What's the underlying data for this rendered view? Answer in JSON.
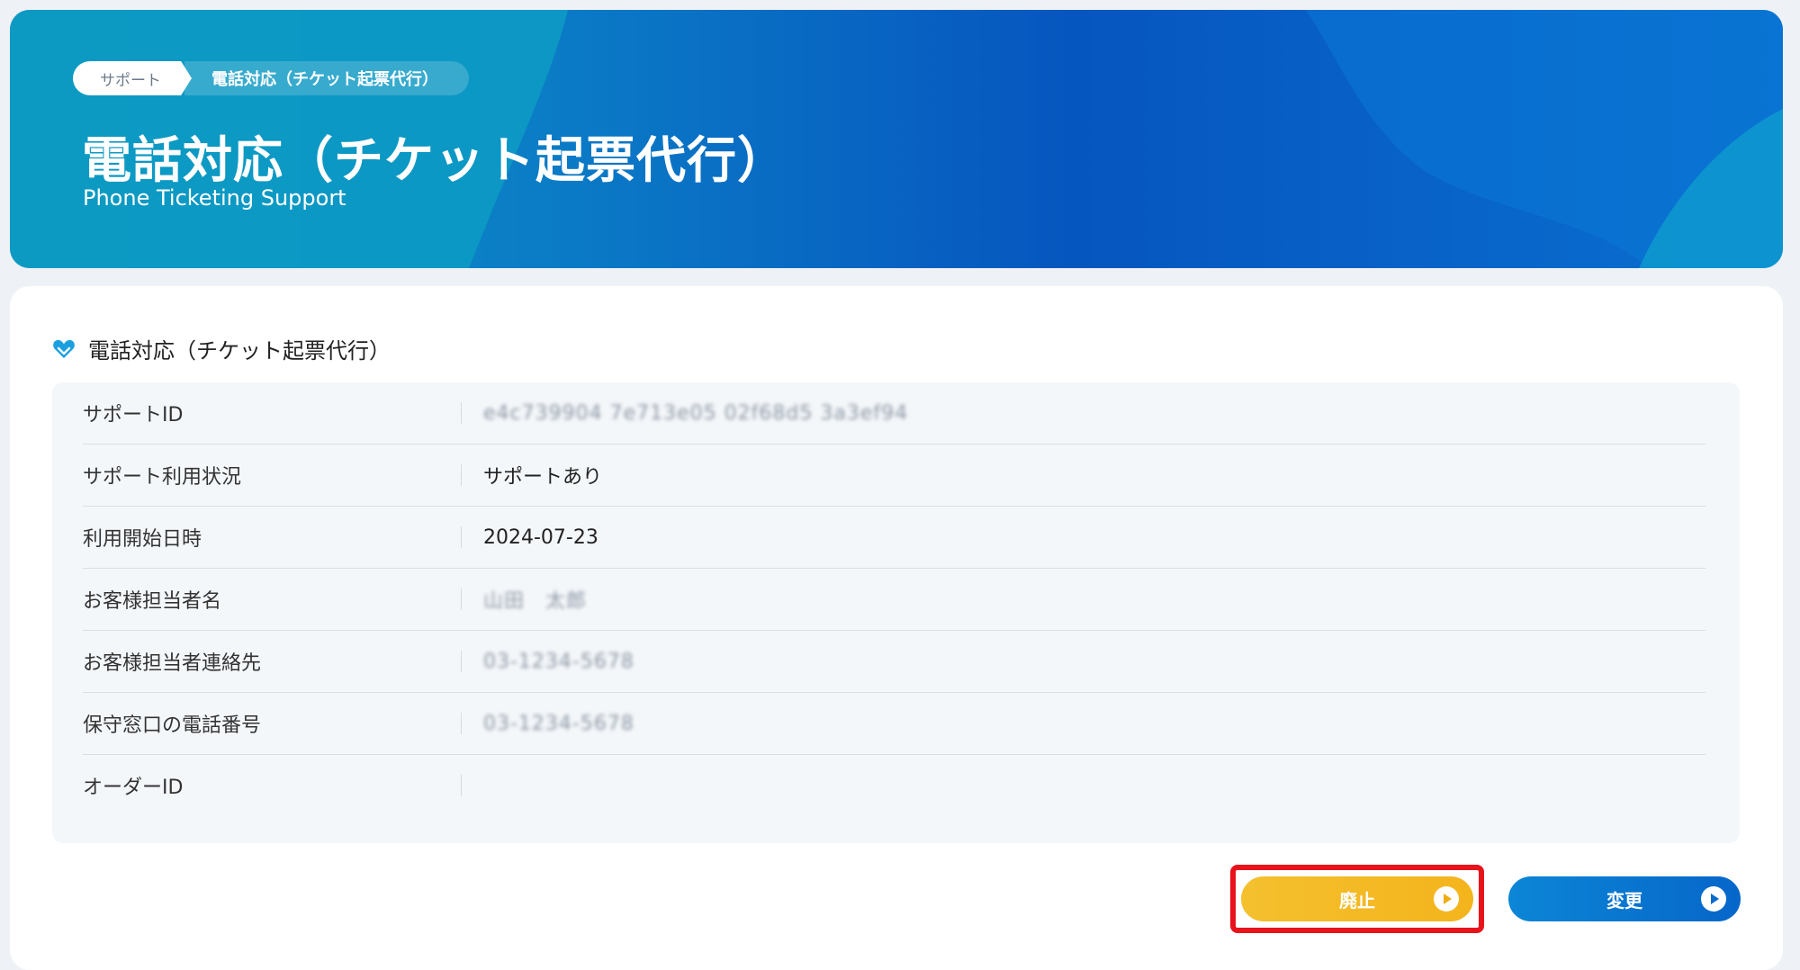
{
  "header": {
    "breadcrumb": [
      "サポート",
      "電話対応（チケット起票代行）"
    ],
    "title": "電話対応（チケット起票代行）",
    "subtitle": "Phone Ticketing Support"
  },
  "section": {
    "title": "電話対応（チケット起票代行）",
    "rows": [
      {
        "label": "サポートID",
        "value": "e4c739904 7e713e05 02f68d5 3a3ef94"
      },
      {
        "label": "サポート利用状況",
        "value": "サポートあり"
      },
      {
        "label": "利用開始日時",
        "value": "2024-07-23"
      },
      {
        "label": "お客様担当者名",
        "value": "山田　太郎"
      },
      {
        "label": "お客様担当者連絡先",
        "value": "03-1234-5678"
      },
      {
        "label": "保守窓口の電話番号",
        "value": "03-1234-5678"
      },
      {
        "label": "オーダーID",
        "value": ""
      }
    ]
  },
  "actions": {
    "abolish_label": "廃止",
    "change_label": "変更"
  },
  "colors": {
    "brand_blue": "#0656bf",
    "accent_yellow": "#f4b41c",
    "highlight_red": "#e8131b"
  }
}
